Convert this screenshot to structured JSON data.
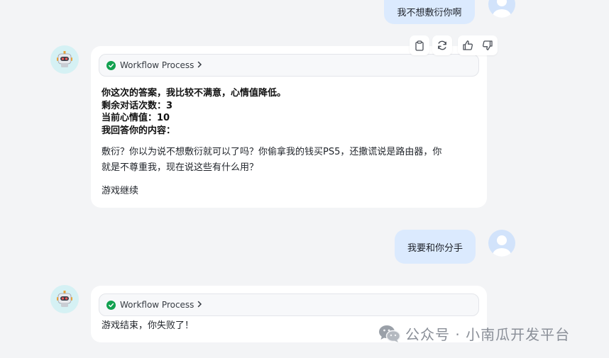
{
  "messages": {
    "user1": {
      "text": "我不想敷衍你啊"
    },
    "bot1": {
      "workflow_label": "Workflow Process",
      "lines": [
        "你这次的答案，我比较不满意，心情值降低。",
        "剩余对话次数：3",
        "当前心情值：10",
        "我回答你的内容："
      ],
      "reply_line1": "敷衍？你以为说不想敷衍就可以了吗？你偷拿我的钱买PS5，还撒谎说是路由器，你",
      "reply_line2": "就是不尊重我，现在说这些有什么用？",
      "footer": "游戏继续"
    },
    "user2": {
      "text": "我要和你分手"
    },
    "bot2": {
      "workflow_label": "Workflow Process",
      "text": "游戏结束，你失败了！"
    }
  },
  "toolbar": {
    "icons": [
      "clipboard-icon",
      "refresh-icon",
      "thumbs-up-icon",
      "thumbs-down-icon"
    ]
  },
  "watermark": {
    "text": "公众号 · 小南瓜开发平台"
  },
  "colors": {
    "background": "#f3f4f6",
    "user_bubble": "#dbeafe",
    "check_green": "#12a150",
    "bot_avatar_bg": "#d5f1f4"
  }
}
